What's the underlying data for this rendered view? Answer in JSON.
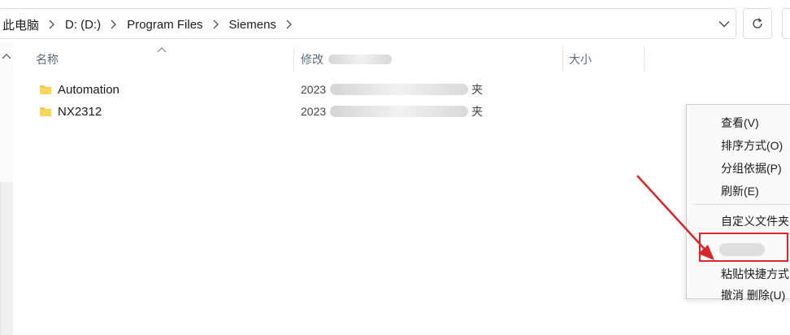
{
  "address_bar": {
    "crumbs": [
      "此电脑",
      "D: (D:)",
      "Program Files",
      "Siemens"
    ]
  },
  "columns": {
    "name": "名称",
    "modified": "修改",
    "size": "大小"
  },
  "files": [
    {
      "name": "Automation",
      "date": "2023",
      "type_tail": "夹"
    },
    {
      "name": "NX2312",
      "date": "2023",
      "type_tail": "夹"
    }
  ],
  "context_menu": {
    "items": [
      "查看(V)",
      "排序方式(O)",
      "分组依据(P)",
      "刷新(E)",
      "自定义文件夹",
      "粘贴快捷方式",
      "撤消 删除(U)"
    ]
  },
  "colors": {
    "folder": "#f8c940",
    "annotation": "#d9262c"
  }
}
